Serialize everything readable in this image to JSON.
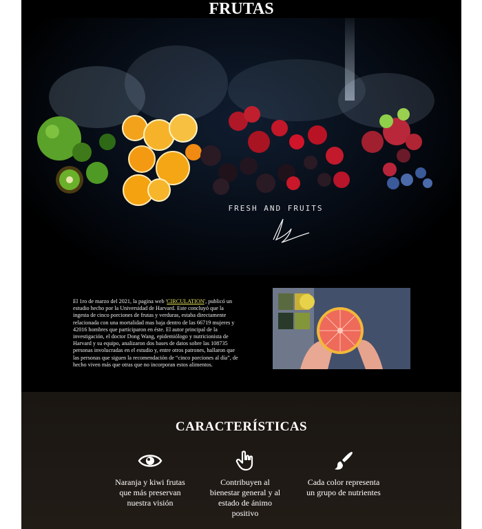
{
  "header": {
    "title": "FRUTAS"
  },
  "hero": {
    "tagline": "FRESH AND FRUITS"
  },
  "intro": {
    "text_before_link": "El 1ro de marzo del 2021, la pagina web '",
    "link_label": "CIRCULATION",
    "text_after_link": "', publicó un estudio hecho por la Universidad de Harvard. Este concluyó que la ingesta de cinco porciones de frutas y verduras, estaba directamente relacionada con una mortalidad mas baja dentro de las 66719 mujeres y 42016 hombres que participaron en éste. El autor principal de la investigación, el doctor Dong Wang, epidemiólogo y nutricionista de Harvard y su equipo, analizaron dos bases de datos sobre las 108735 personas involucradas en el estudio y, entre otros patrones, hallaron que las personas que siguen la recomendación de “cinco porciones al día”, de hecho viven más que otras que no incorporan estos alimentos."
  },
  "features": {
    "title": "CARACTERÍSTICAS",
    "items": [
      {
        "icon": "eye-icon",
        "text": "Naranja y kiwi frutas que más preservan nuestra visión"
      },
      {
        "icon": "hand-pointer-icon",
        "text": "Contribuyen al bienestar general y al estado de ánimo positivo"
      },
      {
        "icon": "paint-brush-icon",
        "text": "Cada color representa un grupo de nutrientes"
      }
    ]
  },
  "colors": {
    "background": "#000000",
    "features_bg": "#1e1914",
    "link": "#e8e55a",
    "text": "#ffffff"
  }
}
